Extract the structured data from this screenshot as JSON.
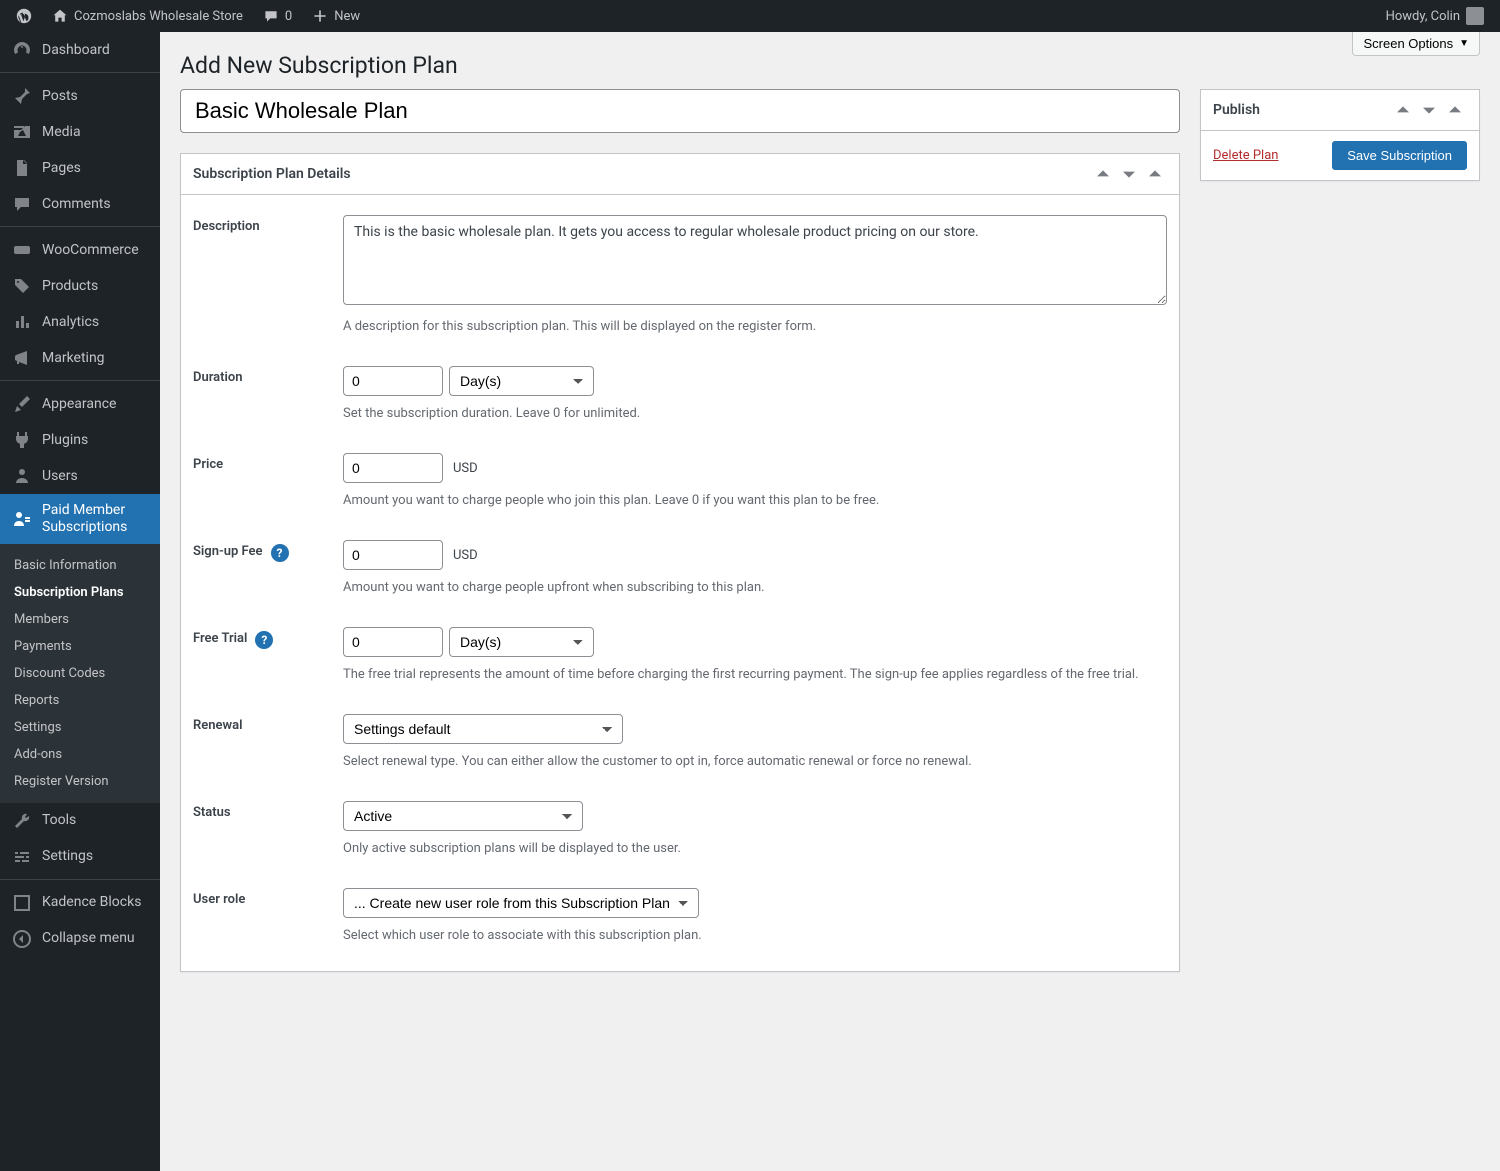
{
  "adminbar": {
    "site_name": "Cozmoslabs Wholesale Store",
    "comments_count": "0",
    "new_label": "New",
    "howdy": "Howdy, Colin"
  },
  "sidebar": {
    "items": [
      {
        "label": "Dashboard"
      },
      {
        "label": "Posts"
      },
      {
        "label": "Media"
      },
      {
        "label": "Pages"
      },
      {
        "label": "Comments"
      },
      {
        "label": "WooCommerce"
      },
      {
        "label": "Products"
      },
      {
        "label": "Analytics"
      },
      {
        "label": "Marketing"
      },
      {
        "label": "Appearance"
      },
      {
        "label": "Plugins"
      },
      {
        "label": "Users"
      },
      {
        "label": "Paid Member Subscriptions"
      },
      {
        "label": "Tools"
      },
      {
        "label": "Settings"
      },
      {
        "label": "Kadence Blocks"
      },
      {
        "label": "Collapse menu"
      }
    ],
    "submenu": [
      {
        "label": "Basic Information"
      },
      {
        "label": "Subscription Plans"
      },
      {
        "label": "Members"
      },
      {
        "label": "Payments"
      },
      {
        "label": "Discount Codes"
      },
      {
        "label": "Reports"
      },
      {
        "label": "Settings"
      },
      {
        "label": "Add-ons"
      },
      {
        "label": "Register Version"
      }
    ]
  },
  "screen_options": "Screen Options",
  "page_title": "Add New Subscription Plan",
  "title_value": "Basic Wholesale Plan",
  "details_box": {
    "heading": "Subscription Plan Details",
    "description": {
      "label": "Description",
      "value": "This is the basic wholesale plan. It gets you access to regular wholesale product pricing on our store.",
      "help": "A description for this subscription plan. This will be displayed on the register form."
    },
    "duration": {
      "label": "Duration",
      "value": "0",
      "unit": "Day(s)",
      "help": "Set the subscription duration. Leave 0 for unlimited."
    },
    "price": {
      "label": "Price",
      "value": "0",
      "currency": "USD",
      "help": "Amount you want to charge people who join this plan. Leave 0 if you want this plan to be free."
    },
    "signup_fee": {
      "label": "Sign-up Fee",
      "value": "0",
      "currency": "USD",
      "help": "Amount you want to charge people upfront when subscribing to this plan."
    },
    "free_trial": {
      "label": "Free Trial",
      "value": "0",
      "unit": "Day(s)",
      "help": "The free trial represents the amount of time before charging the first recurring payment. The sign-up fee applies regardless of the free trial."
    },
    "renewal": {
      "label": "Renewal",
      "value": "Settings default",
      "help": "Select renewal type. You can either allow the customer to opt in, force automatic renewal or force no renewal."
    },
    "status": {
      "label": "Status",
      "value": "Active",
      "help": "Only active subscription plans will be displayed to the user."
    },
    "user_role": {
      "label": "User role",
      "value": "... Create new user role from this Subscription Plan",
      "help": "Select which user role to associate with this subscription plan."
    }
  },
  "publish_box": {
    "heading": "Publish",
    "delete_label": "Delete Plan",
    "save_label": "Save Subscription"
  }
}
